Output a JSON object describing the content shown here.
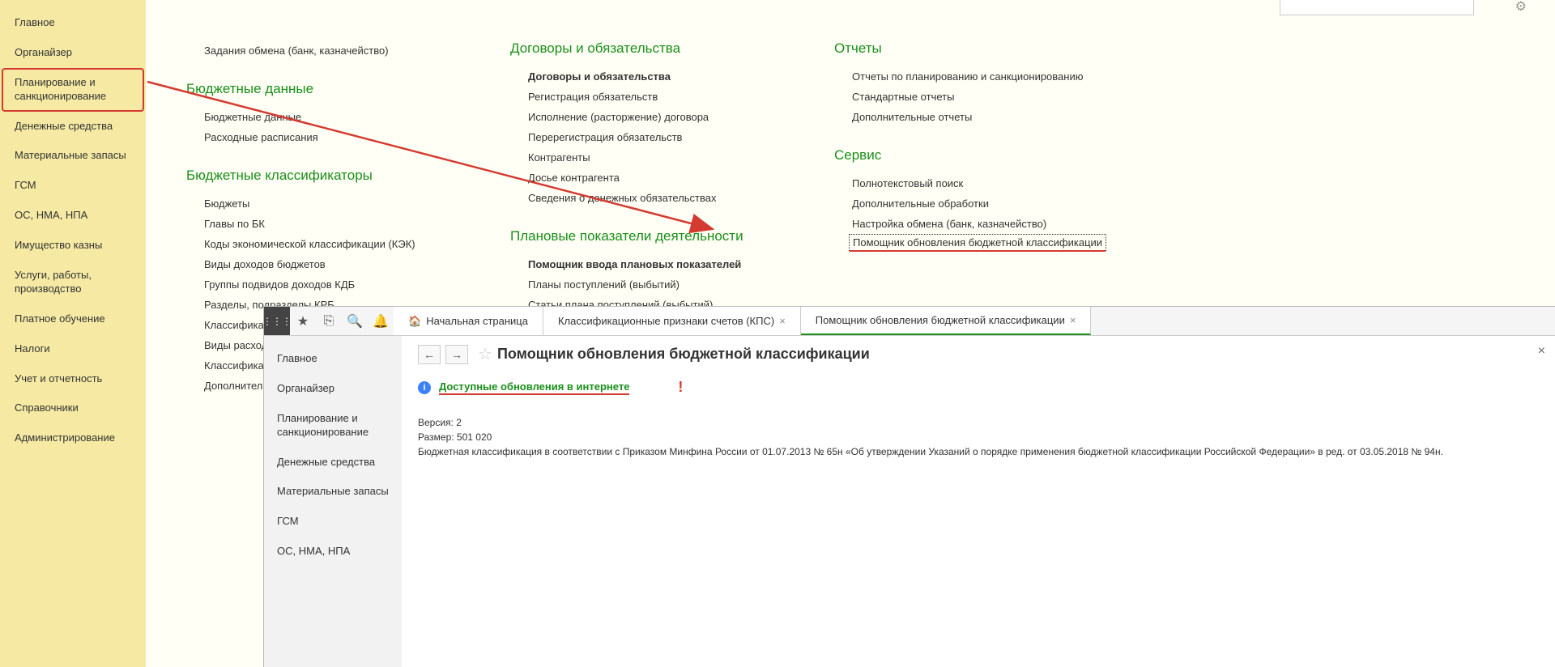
{
  "sidebar": {
    "items": [
      "Главное",
      "Органайзер",
      "Планирование и санкционирование",
      "Денежные средства",
      "Материальные запасы",
      "ГСМ",
      "ОС, НМА, НПА",
      "Имущество казны",
      "Услуги, работы, производство",
      "Платное обучение",
      "Налоги",
      "Учет и отчетность",
      "Справочники",
      "Администрирование"
    ]
  },
  "columns": {
    "col1": {
      "top_links": [
        "Задания обмена (банк, казначейство)"
      ],
      "sec1_title": "Бюджетные данные",
      "sec1_links": [
        "Бюджетные данные",
        "Расходные расписания"
      ],
      "sec2_title": "Бюджетные классификаторы",
      "sec2_links": [
        "Бюджеты",
        "Главы по БК",
        "Коды экономической классификации (КЭК)",
        "Виды доходов бюджетов",
        "Группы подвидов доходов КДБ",
        "Разделы, подразделы КРБ",
        "Классификация",
        "Виды расходов",
        "Классификация",
        "Дополнительные"
      ]
    },
    "col2": {
      "sec1_title": "Договоры и обязательства",
      "sec1_links": [
        {
          "t": "Договоры и обязательства",
          "b": true
        },
        {
          "t": "Регистрация обязательств"
        },
        {
          "t": "Исполнение (расторжение) договора"
        },
        {
          "t": "Перерегистрация обязательств"
        },
        {
          "t": "Контрагенты"
        },
        {
          "t": "Досье контрагента"
        },
        {
          "t": "Сведения о денежных обязательствах"
        }
      ],
      "sec2_title": "Плановые показатели деятельности",
      "sec2_links": [
        {
          "t": "Помощник ввода плановых показателей",
          "b": true
        },
        {
          "t": "Планы поступлений (выбытий)"
        },
        {
          "t": "Статьи плана поступлений (выбытий)"
        }
      ]
    },
    "col3": {
      "sec1_title": "Отчеты",
      "sec1_links": [
        "Отчеты по планированию и санкционированию",
        "Стандартные отчеты",
        "Дополнительные отчеты"
      ],
      "sec2_title": "Сервис",
      "sec2_links": [
        "Полнотекстовый поиск",
        "Дополнительные обработки",
        "Настройка обмена (банк, казначейство)",
        "Помощник обновления бюджетной классификации"
      ]
    }
  },
  "sub": {
    "tabs": [
      {
        "label": "Начальная страница",
        "closable": false,
        "home": true
      },
      {
        "label": "Классификационные признаки счетов (КПС)",
        "closable": true
      },
      {
        "label": "Помощник обновления бюджетной классификации",
        "closable": true,
        "active": true
      }
    ],
    "sidebar": [
      "Главное",
      "Органайзер",
      "Планирование и санкционирование",
      "Денежные средства",
      "Материальные запасы",
      "ГСМ",
      "ОС, НМА, НПА"
    ],
    "title": "Помощник обновления бюджетной классификации",
    "status_link": "Доступные обновления в интернете",
    "version_label": "Версия: 2",
    "size_label": "Размер: 501 020",
    "description": "Бюджетная классификация в соответствии с Приказом Минфина России от 01.07.2013 № 65н «Об утверждении Указаний о порядке применения бюджетной классификации Российской Федерации» в ред. от 03.05.2018 № 94н."
  }
}
